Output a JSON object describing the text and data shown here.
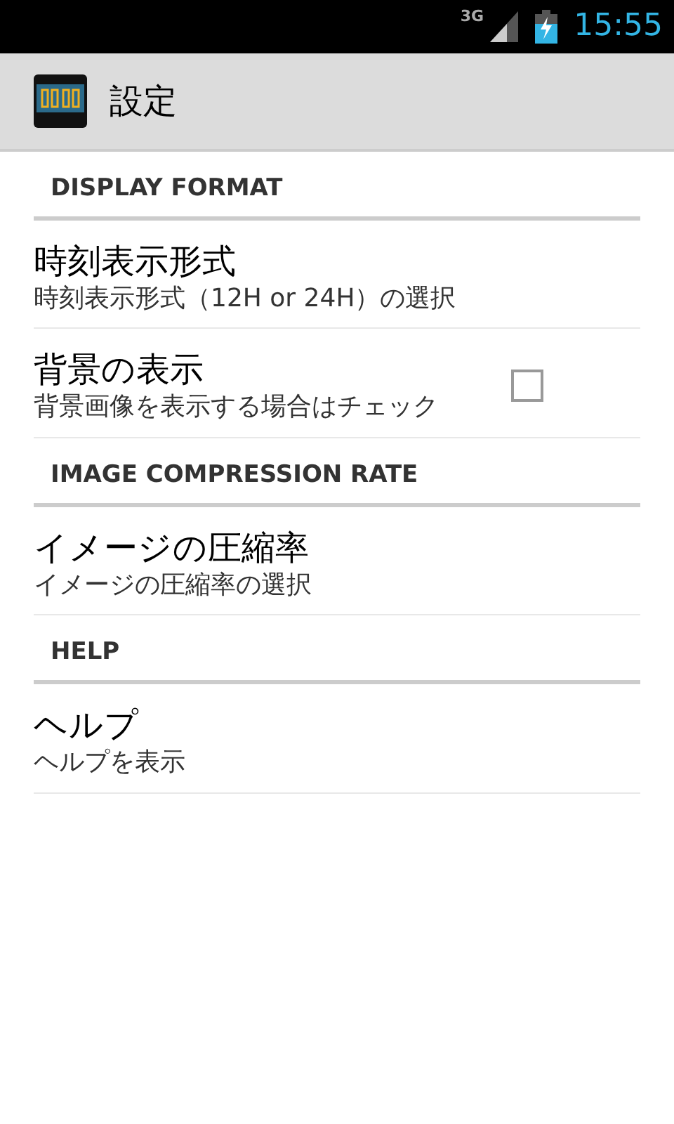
{
  "status_bar": {
    "network": "3G",
    "time": "15:55"
  },
  "action_bar": {
    "title": "設定"
  },
  "sections": [
    {
      "header": "DISPLAY FORMAT",
      "items": [
        {
          "kind": "plain",
          "title": "時刻表示形式",
          "summary": "時刻表示形式（12H or 24H）の選択"
        },
        {
          "kind": "checkbox",
          "title": "背景の表示",
          "summary": "背景画像を表示する場合はチェック",
          "checked": false
        }
      ]
    },
    {
      "header": "IMAGE COMPRESSION RATE",
      "items": [
        {
          "kind": "plain",
          "title": "イメージの圧縮率",
          "summary": "イメージの圧縮率の選択"
        }
      ]
    },
    {
      "header": "HELP",
      "items": [
        {
          "kind": "plain",
          "title": "ヘルプ",
          "summary": "ヘルプを表示"
        }
      ]
    }
  ]
}
